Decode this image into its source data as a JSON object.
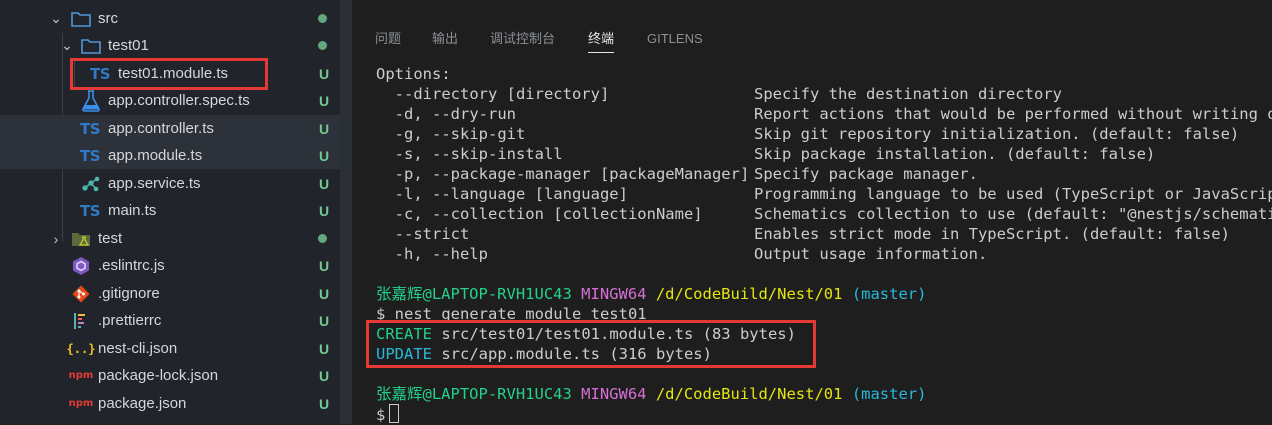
{
  "explorer": {
    "items": [
      {
        "label": "src",
        "icon": "folder-icon",
        "kind": "folder",
        "state": "open",
        "status": "dot"
      },
      {
        "label": "test01",
        "icon": "folder-icon",
        "kind": "folder",
        "state": "open",
        "status": "dot"
      },
      {
        "label": "test01.module.ts",
        "icon": "typescript-icon",
        "icon_text": "TS",
        "kind": "file",
        "status": "U",
        "highlighted": true
      },
      {
        "label": "app.controller.spec.ts",
        "icon": "flask-icon",
        "kind": "file",
        "status": "U"
      },
      {
        "label": "app.controller.ts",
        "icon": "typescript-icon",
        "icon_text": "TS",
        "kind": "file",
        "status": "U"
      },
      {
        "label": "app.module.ts",
        "icon": "typescript-icon",
        "icon_text": "TS",
        "kind": "file",
        "status": "U"
      },
      {
        "label": "app.service.ts",
        "icon": "service-icon",
        "kind": "file",
        "status": "U"
      },
      {
        "label": "main.ts",
        "icon": "typescript-icon",
        "icon_text": "TS",
        "kind": "file",
        "status": "U"
      },
      {
        "label": "test",
        "icon": "test-folder-icon",
        "kind": "folder",
        "state": "closed",
        "status": "dot"
      },
      {
        "label": ".eslintrc.js",
        "icon": "eslint-icon",
        "kind": "file",
        "status": "U"
      },
      {
        "label": ".gitignore",
        "icon": "git-icon",
        "kind": "file",
        "status": "U"
      },
      {
        "label": ".prettierrc",
        "icon": "prettier-icon",
        "kind": "file",
        "status": "U"
      },
      {
        "label": "nest-cli.json",
        "icon": "json-icon",
        "icon_text": "{..}",
        "kind": "file",
        "status": "U"
      },
      {
        "label": "package-lock.json",
        "icon": "npm-icon",
        "icon_text": "npm",
        "kind": "file",
        "status": "U"
      },
      {
        "label": "package.json",
        "icon": "npm-icon",
        "icon_text": "npm",
        "kind": "file",
        "status": "U"
      }
    ]
  },
  "panel": {
    "tabs": [
      {
        "label": "问题",
        "active": false
      },
      {
        "label": "输出",
        "active": false
      },
      {
        "label": "调试控制台",
        "active": false
      },
      {
        "label": "终端",
        "active": true
      },
      {
        "label": "GITLENS",
        "active": false
      }
    ]
  },
  "terminal": {
    "options_header": "Options:",
    "options": [
      {
        "flag": "  --directory [directory]",
        "desc": "Specify the destination directory"
      },
      {
        "flag": "  -d, --dry-run",
        "desc": "Report actions that would be performed without writing out"
      },
      {
        "flag": "  -g, --skip-git",
        "desc": "Skip git repository initialization. (default: false)"
      },
      {
        "flag": "  -s, --skip-install",
        "desc": "Skip package installation. (default: false)"
      },
      {
        "flag": "  -p, --package-manager [packageManager]",
        "desc": "Specify package manager."
      },
      {
        "flag": "  -l, --language [language]",
        "desc": "Programming language to be used (TypeScript or JavaScript)"
      },
      {
        "flag": "  -c, --collection [collectionName]",
        "desc": "Schematics collection to use (default: \"@nestjs/schematics"
      },
      {
        "flag": "  --strict",
        "desc": "Enables strict mode in TypeScript. (default: false)"
      },
      {
        "flag": "  -h, --help",
        "desc": "Output usage information."
      }
    ],
    "prompt1": {
      "user": "张嘉辉@LAPTOP-RVH1UC43",
      "env": "MINGW64",
      "path": "/d/CodeBuild/Nest/01",
      "branch": "(master)"
    },
    "command": "$ nest generate module test01",
    "results": [
      {
        "action": "CREATE",
        "text": "src/test01/test01.module.ts (83 bytes)"
      },
      {
        "action": "UPDATE",
        "text": "src/app.module.ts (316 bytes)"
      }
    ],
    "prompt2": {
      "user": "张嘉辉@LAPTOP-RVH1UC43",
      "env": "MINGW64",
      "path": "/d/CodeBuild/Nest/01",
      "branch": "(master)"
    },
    "input_prompt": "$"
  },
  "colors": {
    "accent_highlight": "#e53935",
    "git_untracked": "#73c991",
    "terminal_green": "#23d18b",
    "terminal_magenta": "#d670d6",
    "terminal_yellow": "#e5e510",
    "terminal_cyan": "#29b8db"
  }
}
